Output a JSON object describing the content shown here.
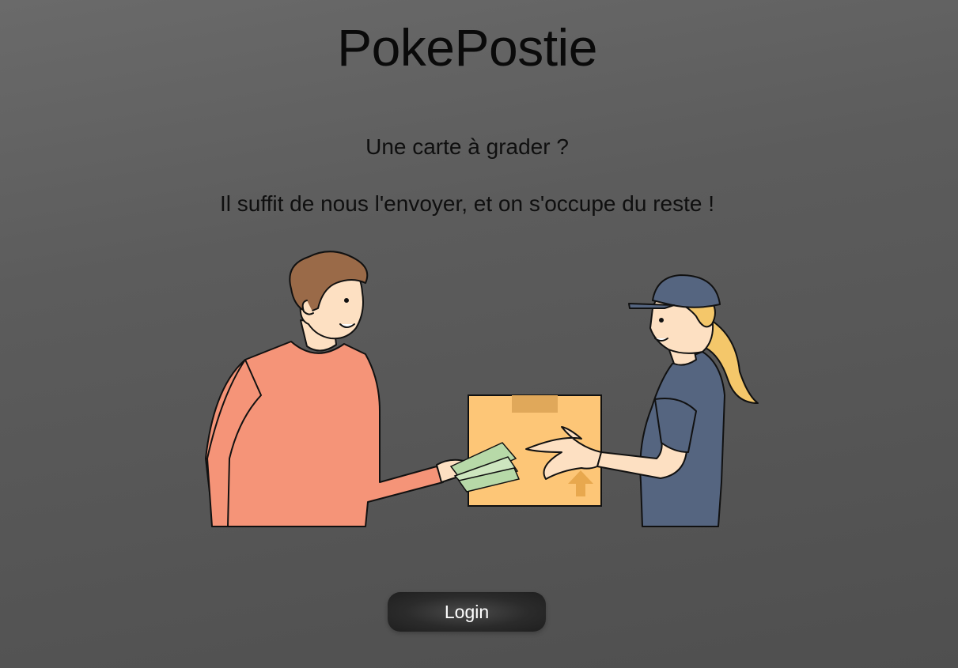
{
  "header": {
    "title": "PokePostie"
  },
  "hero": {
    "tagline_1": "Une carte à grader ?",
    "tagline_2": "Il suffit de nous l'envoyer, et on s'occupe du reste !"
  },
  "illustration": {
    "icon": "delivery-handoff-illustration",
    "colors": {
      "sweater": "#f59478",
      "hair_man": "#9a6a48",
      "skin": "#fde0c2",
      "box": "#fdc677",
      "box_tape": "#e0a85a",
      "uniform": "#556580",
      "cap": "#556580",
      "hair_woman": "#f4c76a",
      "money": "#b7d9a8"
    }
  },
  "actions": {
    "login_label": "Login"
  }
}
